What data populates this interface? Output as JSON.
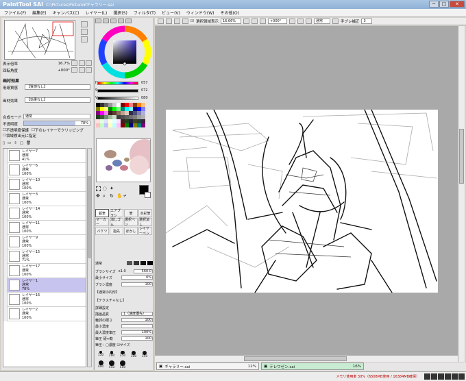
{
  "window": {
    "app_logo": "PaintTool SAI",
    "title": "C:\\Pictures\\Picture¥ギャラリー.sai",
    "min": "─",
    "max": "□",
    "close": "✕"
  },
  "menu": [
    "ファイル(F)",
    "編集(E)",
    "キャンバス(C)",
    "レイヤー(L)",
    "選択(S)",
    "フィルタ(T)",
    "ビュー(V)",
    "ウィンドウ(W)",
    "その他(O)"
  ],
  "navigator": {
    "zoom_label": "表示倍率",
    "zoom_value": "16.7%",
    "rotate_label": "回転角度",
    "rotate_value": "+000°"
  },
  "paper_effect": {
    "header": "画材効果",
    "texture_label": "用紙質感",
    "texture_value": "【質感なし】",
    "effect_label": "画材効果",
    "effect_value": "【効果なし】"
  },
  "layer_settings": {
    "blend_label": "合成モード",
    "blend_value": "通常",
    "opacity_label": "不透明度",
    "opacity_value": "78%",
    "check1": "不透明度保護",
    "check2": "下のレイヤーでクリッピング",
    "check3": "領域検出元に指定"
  },
  "layers": [
    {
      "name": "レイヤー7",
      "mode": "通常",
      "opacity": "41%"
    },
    {
      "name": "レイヤー6",
      "mode": "通常",
      "opacity": "100%"
    },
    {
      "name": "レイヤー10",
      "mode": "通常",
      "opacity": "100%"
    },
    {
      "name": "レイヤー3",
      "mode": "通常",
      "opacity": "100%"
    },
    {
      "name": "レイヤー14",
      "mode": "通常",
      "opacity": "100%"
    },
    {
      "name": "レイヤー11",
      "mode": "通常",
      "opacity": "100%"
    },
    {
      "name": "レイヤー9",
      "mode": "通常",
      "opacity": "100%"
    },
    {
      "name": "レイヤー15",
      "mode": "通常",
      "opacity": "71%"
    },
    {
      "name": "レイヤー17",
      "mode": "通常",
      "opacity": "100%"
    },
    {
      "name": "レイヤー1",
      "mode": "通常",
      "opacity": "78%",
      "selected": true
    },
    {
      "name": "レイヤー16",
      "mode": "通常",
      "opacity": "100%"
    },
    {
      "name": "レイヤー2",
      "mode": "通常",
      "opacity": "100%"
    }
  ],
  "color": {
    "h_label": "H",
    "h_value": "057",
    "s_label": "S",
    "s_value": "072",
    "v_label": "V",
    "v_value": "080",
    "swatch_colors": [
      "#000000",
      "#333333",
      "#666666",
      "#999999",
      "#cccccc",
      "#ffffff",
      "#7f0000",
      "#ff0000",
      "#ff7f7f",
      "#7f3f00",
      "#ff7f00",
      "#ffbf7f",
      "#7f7f00",
      "#ffff00",
      "#ffff7f",
      "#007f00",
      "#00ff00",
      "#7fff7f",
      "#007f7f",
      "#00ffff",
      "#7fffff",
      "#00007f",
      "#0000ff",
      "#7f7fff",
      "#7f007f",
      "#ff00ff",
      "#ff7fff",
      "#3f1f1f",
      "#5f3f2f",
      "#8f6f5f",
      "#bfa08f",
      "#e0c8b8",
      "#2f2f4f",
      "#4f4f7f",
      "#7f7faf",
      "#afafdf",
      "#1f3f1f",
      "#3f5f3f",
      "#6f8f6f",
      "#9fbf9f",
      "#cfdfcf",
      "#404040",
      "#505050",
      "#606060",
      "#707070",
      "#808080",
      "#a0a0a0",
      "#b0b0b0",
      "#ffe0e0",
      "#e0ffe0",
      "#e0e0ff",
      "#ffffe0",
      "#e0ffff",
      "#ffe0ff",
      "#402020",
      "#204020",
      "#202040",
      "#404020",
      "#204040",
      "#402040",
      "#ffc0c0",
      "#c0ffc0",
      "#c0c0ff",
      "#ffffc0",
      "#c0ffff",
      "#ffc0ff",
      "#800000",
      "#008000",
      "#000080",
      "#808000",
      "#008080",
      "#800080"
    ]
  },
  "tools": {
    "tool_grid": [
      "鉛筆",
      "エアブラシ",
      "筆",
      "水彩筆",
      "マーカー",
      "消しゴム",
      "選択ペン",
      "選択消し",
      "バケツ",
      "指先",
      "ぼかし",
      "レイヤーペン"
    ],
    "active_tool": "鉛筆"
  },
  "brush_props": {
    "shape_label": "通常",
    "size_label": "ブラシサイズ",
    "size_mult": "x1.0",
    "size_value": "560.0",
    "min_size_label": "最小サイズ",
    "min_size_value": "0%",
    "density_label": "ブラシ濃度",
    "density_value": "100",
    "shape_opt": "【通常の円形】",
    "texture_opt": "【テクスチャなし】",
    "detail_header": "詳細設定",
    "quality_label": "描画品質",
    "quality_value": "1（速度優先）",
    "edge_label": "輪郭の硬さ",
    "edge_value": "100",
    "min_density_label": "最小濃度",
    "min_density_value": "",
    "max_density_label": "最大濃度筆圧",
    "max_density_value": "100%",
    "pressure_label": "筆圧 硬⇔軟",
    "pressure_value": "100",
    "pressure_opts": "筆圧：□濃度 ☑サイズ",
    "presets": [
      "150",
      "200",
      "250",
      "300",
      "350",
      "400",
      "450",
      "500"
    ]
  },
  "toolbar": {
    "check_label": "選択領域表示",
    "zoom": "16.66%",
    "rotate": "+000°",
    "mode": "通常",
    "stab_label": "手ブレ補正",
    "stab_value": "3"
  },
  "tabs": [
    {
      "name": "ギャラリー.sai",
      "pct": "12%",
      "active": false
    },
    {
      "name": "テレワゼン.sai",
      "pct": "16%",
      "active": true
    }
  ],
  "status": {
    "memory": "メモリ使用率 30%（6508MB使用 / 16384MB確保）"
  }
}
